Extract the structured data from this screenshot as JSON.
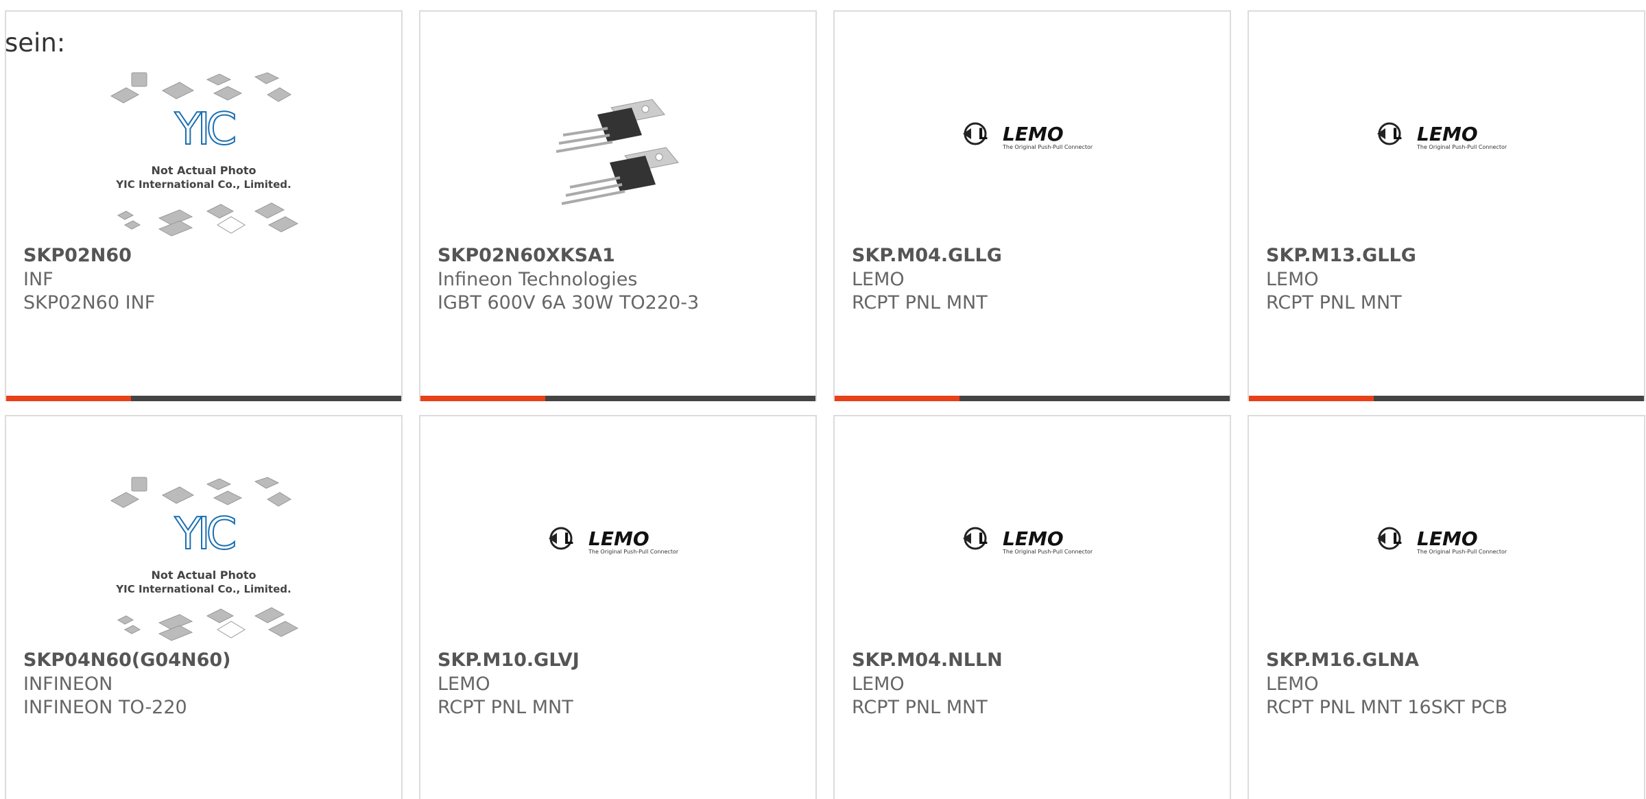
{
  "intro_text": "sein:",
  "products": [
    {
      "part_number": "SKP02N60",
      "manufacturer": "INF",
      "description": "SKP02N60 INF",
      "image": "placeholder-yic-icon"
    },
    {
      "part_number": "SKP02N60XKSA1",
      "manufacturer": "Infineon Technologies",
      "description": "IGBT 600V 6A 30W TO220-3",
      "image": "to220-transistor-icon"
    },
    {
      "part_number": "SKP.M04.GLLG",
      "manufacturer": "LEMO",
      "description": "RCPT PNL MNT",
      "image": "lemo-logo"
    },
    {
      "part_number": "SKP.M13.GLLG",
      "manufacturer": "LEMO",
      "description": "RCPT PNL MNT",
      "image": "lemo-logo"
    },
    {
      "part_number": "SKP04N60(G04N60)",
      "manufacturer": "INFINEON",
      "description": "INFINEON TO-220",
      "image": "placeholder-yic-icon"
    },
    {
      "part_number": "SKP.M10.GLVJ",
      "manufacturer": "LEMO",
      "description": "RCPT PNL MNT",
      "image": "lemo-logo"
    },
    {
      "part_number": "SKP.M04.NLLN",
      "manufacturer": "LEMO",
      "description": "RCPT PNL MNT",
      "image": "lemo-logo"
    },
    {
      "part_number": "SKP.M16.GLNA",
      "manufacturer": "LEMO",
      "description": "RCPT PNL MNT 16SKT PCB",
      "image": "lemo-logo"
    }
  ],
  "placeholder": {
    "line1": "Not Actual Photo",
    "line2": "YIC International Co., Limited.",
    "logo": "YIC"
  },
  "lemo": {
    "brand": "LEMO",
    "tagline": "The Original Push-Pull Connector"
  },
  "colors": {
    "accent": "#e8411a",
    "bar": "#444444",
    "border": "#dcdcdc"
  }
}
